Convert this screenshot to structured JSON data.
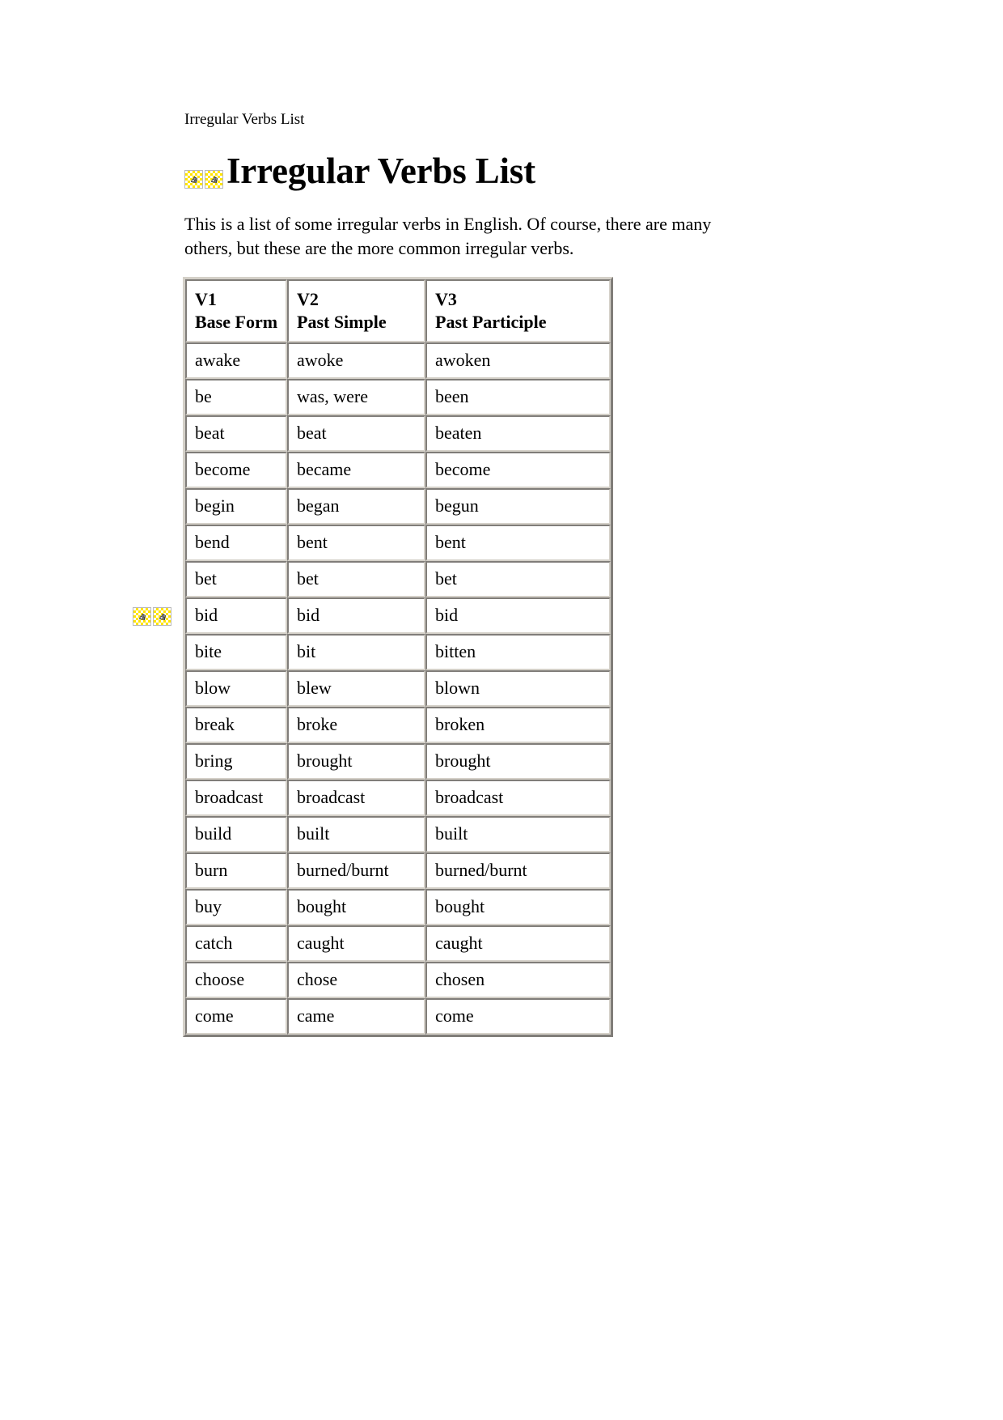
{
  "document": {
    "running_header": "Irregular Verbs List",
    "title": "Irregular Verbs List",
    "intro": "This is a list of some irregular verbs in English. Of course, there are many others, but these are the more common irregular verbs."
  },
  "icons": {
    "title_placeholder_1": "broken-image-icon",
    "title_placeholder_2": "broken-image-icon",
    "margin_placeholder_1": "broken-image-icon",
    "margin_placeholder_2": "broken-image-icon",
    "checker_color": "#ffe400",
    "glyph_color": "#808080"
  },
  "table": {
    "headers": [
      {
        "code": "V1",
        "name": "Base Form"
      },
      {
        "code": "V2",
        "name": "Past Simple"
      },
      {
        "code": "V3",
        "name": "Past Participle"
      }
    ],
    "rows": [
      {
        "v1": "awake",
        "v2": "awoke",
        "v3": "awoken"
      },
      {
        "v1": "be",
        "v2": "was, were",
        "v3": "been"
      },
      {
        "v1": "beat",
        "v2": "beat",
        "v3": "beaten"
      },
      {
        "v1": "become",
        "v2": "became",
        "v3": "become"
      },
      {
        "v1": "begin",
        "v2": "began",
        "v3": "begun"
      },
      {
        "v1": "bend",
        "v2": "bent",
        "v3": "bent"
      },
      {
        "v1": "bet",
        "v2": "bet",
        "v3": "bet"
      },
      {
        "v1": "bid",
        "v2": "bid",
        "v3": "bid"
      },
      {
        "v1": "bite",
        "v2": "bit",
        "v3": "bitten"
      },
      {
        "v1": "blow",
        "v2": "blew",
        "v3": "blown"
      },
      {
        "v1": "break",
        "v2": "broke",
        "v3": "broken"
      },
      {
        "v1": "bring",
        "v2": "brought",
        "v3": "brought"
      },
      {
        "v1": "broadcast",
        "v2": "broadcast",
        "v3": "broadcast"
      },
      {
        "v1": "build",
        "v2": "built",
        "v3": "built"
      },
      {
        "v1": "burn",
        "v2": "burned/burnt",
        "v3": "burned/burnt"
      },
      {
        "v1": "buy",
        "v2": "bought",
        "v3": "bought"
      },
      {
        "v1": "catch",
        "v2": "caught",
        "v3": "caught"
      },
      {
        "v1": "choose",
        "v2": "chose",
        "v3": "chosen"
      },
      {
        "v1": "come",
        "v2": "came",
        "v3": "come"
      }
    ]
  }
}
